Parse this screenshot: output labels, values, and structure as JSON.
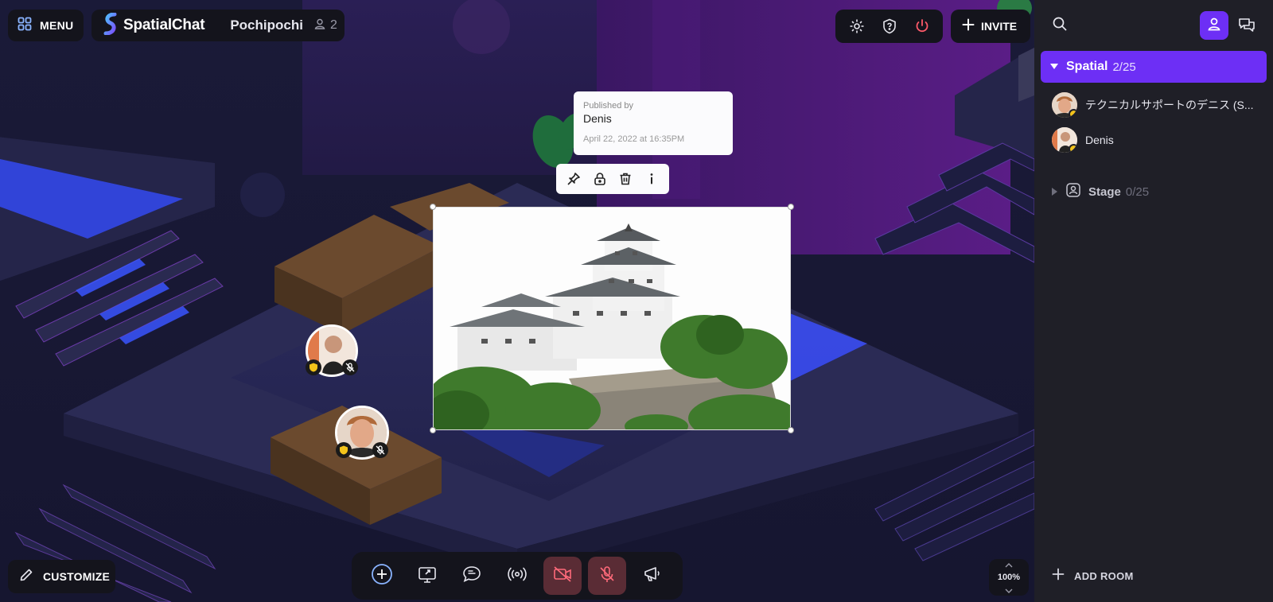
{
  "top_bar": {
    "menu_label": "MENU",
    "brand_name": "SpatialChat",
    "space_name": "Pochipochi",
    "user_count": "2",
    "invite_label": "INVITE"
  },
  "image_card": {
    "published_by_label": "Published by",
    "publisher_name": "Denis",
    "published_date": "April 22, 2022 at 16:35PM"
  },
  "bottom_bar": {
    "customize_label": "CUSTOMIZE",
    "zoom_level": "100%"
  },
  "sidebar": {
    "rooms": [
      {
        "name": "Spatial",
        "count": "2/25",
        "expanded": true,
        "members": [
          {
            "name": "テクニカルサポートのデニス (S..."
          },
          {
            "name": "Denis"
          }
        ]
      },
      {
        "name": "Stage",
        "count": "0/25",
        "expanded": false
      }
    ],
    "add_room_label": "ADD ROOM"
  },
  "colors": {
    "accent": "#6d2ff5",
    "danger_btn": "#5a2c35",
    "panel": "#14141c",
    "sidebar_bg": "#1f1f27"
  }
}
